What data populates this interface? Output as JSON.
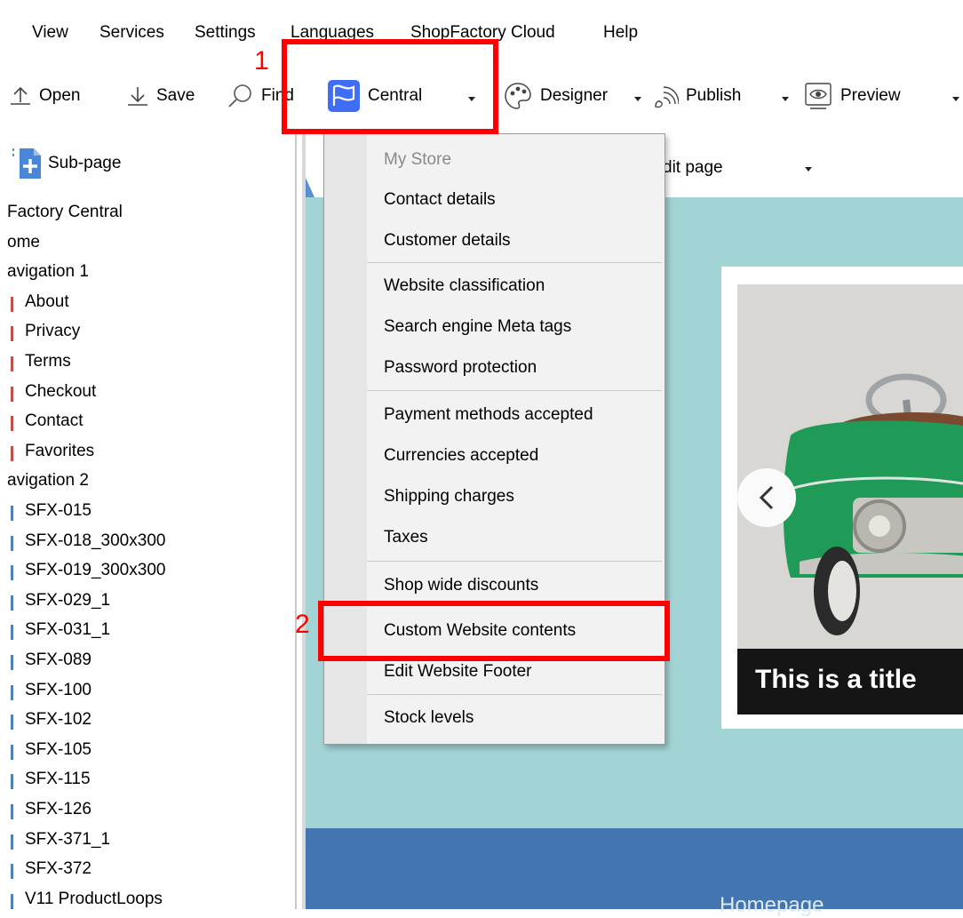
{
  "menubar": {
    "items": [
      "View",
      "Services",
      "Settings",
      "Languages",
      "ShopFactory Cloud",
      "Help"
    ]
  },
  "toolbar": {
    "open": "Open",
    "save": "Save",
    "find": "Find",
    "central": "Central",
    "designer": "Designer",
    "publish": "Publish",
    "preview": "Preview"
  },
  "left_panel": {
    "subpage_button": "Sub-page",
    "tree": [
      {
        "label": "Factory Central",
        "marker": "none"
      },
      {
        "label": "ome",
        "marker": "none"
      },
      {
        "label": "avigation 1",
        "marker": "none"
      },
      {
        "label": "About",
        "marker": "red"
      },
      {
        "label": "Privacy",
        "marker": "red"
      },
      {
        "label": "Terms",
        "marker": "red"
      },
      {
        "label": "Checkout",
        "marker": "red"
      },
      {
        "label": "Contact",
        "marker": "red"
      },
      {
        "label": "Favorites",
        "marker": "red"
      },
      {
        "label": "avigation 2",
        "marker": "none"
      },
      {
        "label": "SFX-015",
        "marker": "blue"
      },
      {
        "label": "SFX-018_300x300",
        "marker": "blue"
      },
      {
        "label": "SFX-019_300x300",
        "marker": "blue"
      },
      {
        "label": "SFX-029_1",
        "marker": "blue"
      },
      {
        "label": "SFX-031_1",
        "marker": "blue"
      },
      {
        "label": "SFX-089",
        "marker": "blue"
      },
      {
        "label": "SFX-100",
        "marker": "blue"
      },
      {
        "label": "SFX-102",
        "marker": "blue"
      },
      {
        "label": "SFX-105",
        "marker": "blue"
      },
      {
        "label": "SFX-115",
        "marker": "blue"
      },
      {
        "label": "SFX-126",
        "marker": "blue"
      },
      {
        "label": "SFX-371_1",
        "marker": "blue"
      },
      {
        "label": "SFX-372",
        "marker": "blue"
      },
      {
        "label": "V11 ProductLoops",
        "marker": "blue"
      }
    ]
  },
  "editor": {
    "edit_page_label": "dit page",
    "slide_title": "This is a title",
    "footer_text": "Homepage"
  },
  "dropdown": {
    "items": [
      {
        "label": "My Store",
        "disabled": true
      },
      {
        "label": "Contact details"
      },
      {
        "label": "Customer details"
      },
      {
        "label": "Website classification"
      },
      {
        "label": "Search engine Meta tags"
      },
      {
        "label": "Password protection"
      },
      {
        "label": "Payment methods accepted"
      },
      {
        "label": "Currencies accepted"
      },
      {
        "label": "Shipping charges"
      },
      {
        "label": "Taxes"
      },
      {
        "label": "Shop wide discounts"
      },
      {
        "label": "Custom Website contents"
      },
      {
        "label": "Edit Website Footer"
      },
      {
        "label": "Stock levels"
      }
    ]
  },
  "annotations": {
    "step1": "1",
    "step2": "2"
  },
  "colors": {
    "annotation": "#ff0000",
    "canvas_bg": "#a3d4d5",
    "footer_band": "#4376b0",
    "central_icon": "#3f6ef5",
    "tree_marker_red": "#c0504d",
    "tree_marker_blue": "#4f81bd"
  }
}
